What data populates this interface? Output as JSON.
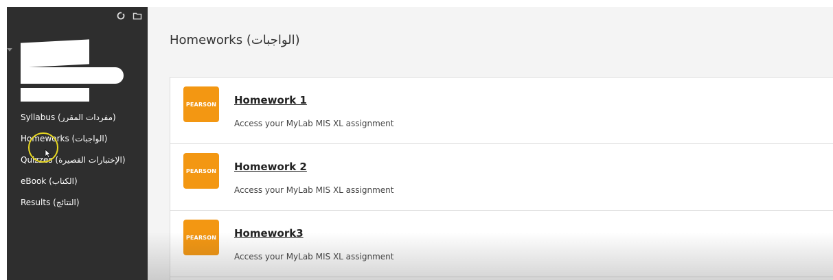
{
  "sidebar": {
    "toolbar": {
      "icons": [
        "refresh-icon",
        "folder-icon"
      ]
    },
    "items": [
      {
        "label": "Syllabus (مفردات المقرر)"
      },
      {
        "label": "Homeworks (الواجبات)"
      },
      {
        "label": "Quizzes (الإختبارات القصيرة)"
      },
      {
        "label": "eBook (الكتاب)"
      },
      {
        "label": "Results (النتائج)"
      }
    ]
  },
  "main": {
    "title": "Homeworks (الواجبات)",
    "items": [
      {
        "logo": "PEARSON",
        "title": "Homework 1",
        "description": "Access your MyLab MIS XL assignment"
      },
      {
        "logo": "PEARSON",
        "title": "Homework 2",
        "description": "Access your MyLab MIS XL assignment"
      },
      {
        "logo": "PEARSON",
        "title": "Homework3",
        "description": "Access your MyLab MIS XL assignment"
      }
    ]
  },
  "colors": {
    "sidebar_bg": "#2e2e2e",
    "pearson_orange": "#f39712",
    "cursor_highlight": "#e8d820"
  }
}
